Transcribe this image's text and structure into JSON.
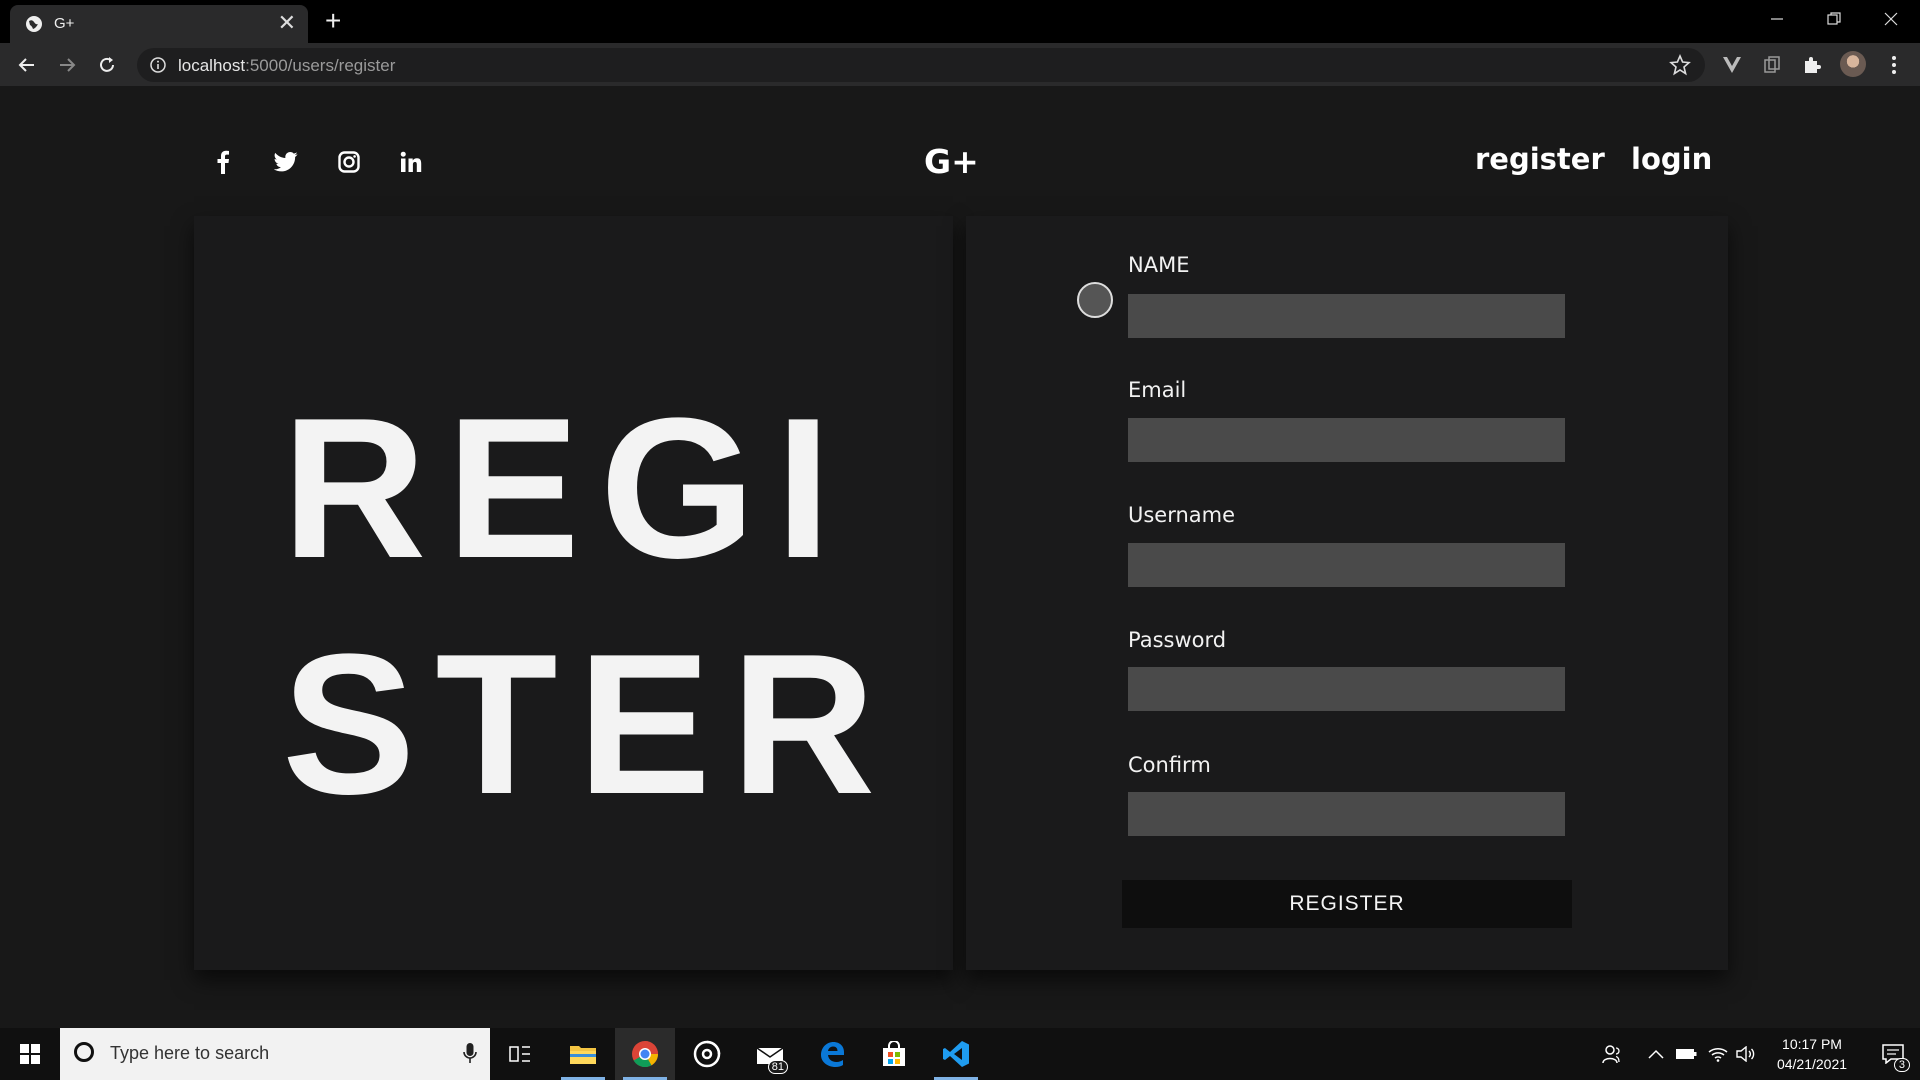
{
  "browser": {
    "tab_title": "G+",
    "tab_close": "✕",
    "new_tab": "+",
    "url_host": "localhost",
    "url_path": ":5000/users/register"
  },
  "site": {
    "brand": "G+",
    "nav": {
      "register": "register",
      "login": "login"
    },
    "social": [
      "facebook-icon",
      "twitter-icon",
      "instagram-icon",
      "linkedin-icon"
    ]
  },
  "hero": {
    "title": "REGISTER"
  },
  "form": {
    "fields": [
      {
        "label": "NAME",
        "value": ""
      },
      {
        "label": "Email",
        "value": ""
      },
      {
        "label": "Username",
        "value": ""
      },
      {
        "label": "Password",
        "value": ""
      },
      {
        "label": "Confirm",
        "value": ""
      }
    ],
    "submit_label": "REGISTER"
  },
  "taskbar": {
    "search_placeholder": "Type here to search",
    "mail_badge": "81",
    "time": "10:17 PM",
    "date": "04/21/2021",
    "notifications": "3"
  },
  "colors": {
    "page_bg": "#181818",
    "card_bg": "#1a1a1b",
    "input_bg": "#4a4a4a",
    "button_bg": "#0e0e0e",
    "text": "#f2f2f2"
  }
}
